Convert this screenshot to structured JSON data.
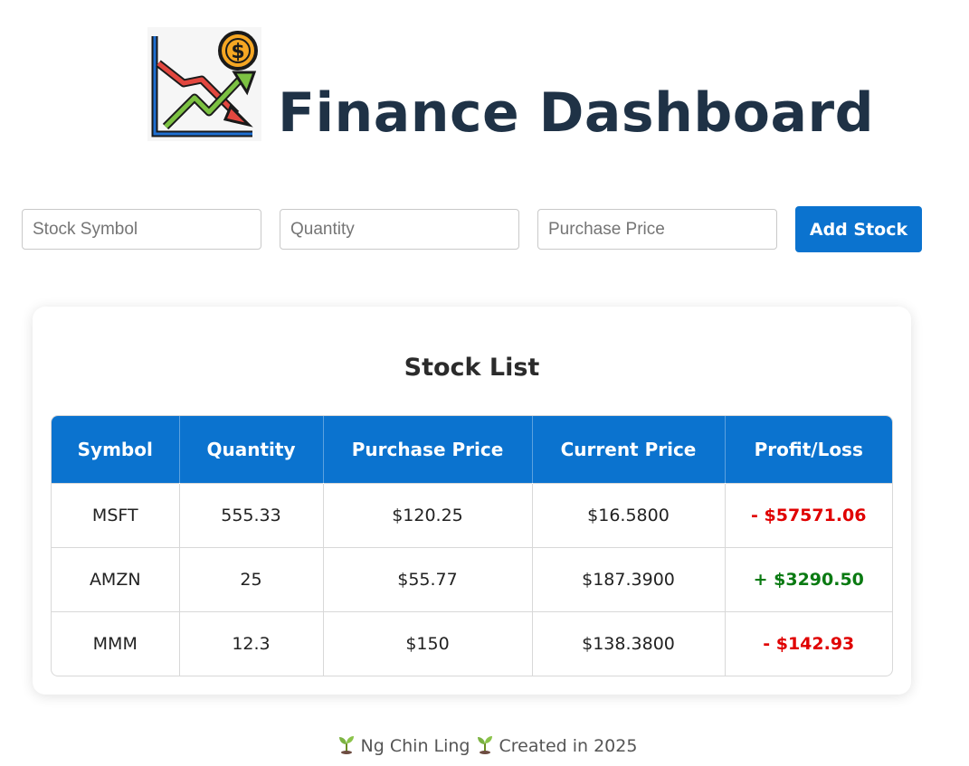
{
  "header": {
    "title": "Finance Dashboard",
    "logo_icon": "finance-chart-icon"
  },
  "form": {
    "symbol_placeholder": "Stock Symbol",
    "quantity_placeholder": "Quantity",
    "price_placeholder": "Purchase Price",
    "add_label": "Add Stock"
  },
  "stock_list": {
    "title": "Stock List",
    "columns": [
      "Symbol",
      "Quantity",
      "Purchase Price",
      "Current Price",
      "Profit/Loss"
    ],
    "rows": [
      {
        "symbol": "MSFT",
        "quantity": "555.33",
        "purchase": "$120.25",
        "current": "$16.5800",
        "pl": "- $57571.06",
        "status": "loss"
      },
      {
        "symbol": "AMZN",
        "quantity": "25",
        "purchase": "$55.77",
        "current": "$187.3900",
        "pl": "+ $3290.50",
        "status": "gain"
      },
      {
        "symbol": "MMM",
        "quantity": "12.3",
        "purchase": "$150",
        "current": "$138.3800",
        "pl": "- $142.93",
        "status": "loss"
      }
    ]
  },
  "footer": {
    "author": "Ng Chin Ling",
    "created": "Created in 2025"
  },
  "colors": {
    "accent": "#0b73cf",
    "loss": "#e00000",
    "gain": "#0a7a12",
    "title": "#1f3246"
  }
}
